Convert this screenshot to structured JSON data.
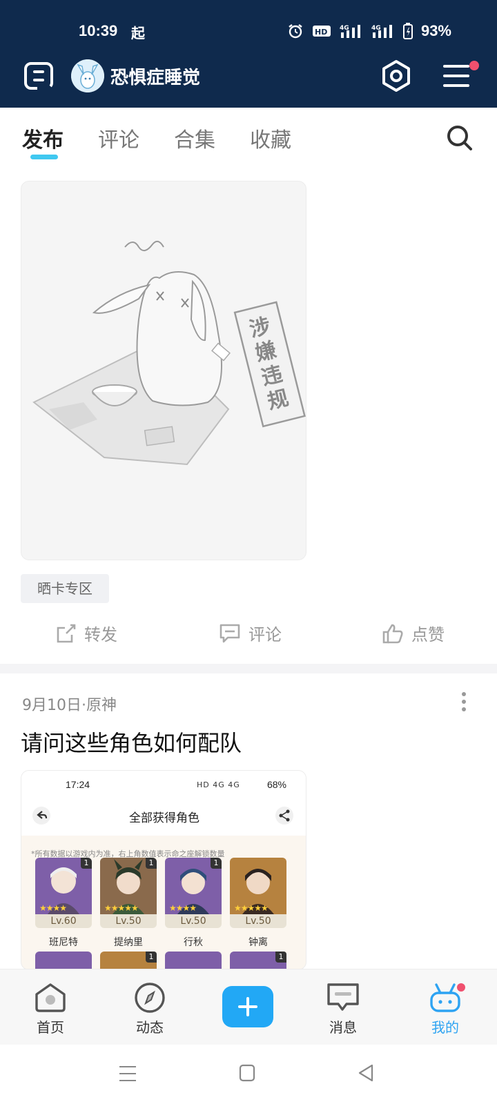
{
  "status_bar": {
    "time": "10:39",
    "extra": "起",
    "battery": "93%"
  },
  "header": {
    "username": "恐惧症睡觉",
    "has_notification_dot": true,
    "background_color": "#0f2a4d"
  },
  "tabs": [
    {
      "label": "发布",
      "active": true
    },
    {
      "label": "评论",
      "active": false
    },
    {
      "label": "合集",
      "active": false
    },
    {
      "label": "收藏",
      "active": false
    }
  ],
  "post1": {
    "image_text": "涉嫌违规",
    "tag": "晒卡专区",
    "actions": {
      "share": "转发",
      "comment": "评论",
      "like": "点赞"
    }
  },
  "post2": {
    "meta": "9月10日·原神",
    "title": "请问这些角色如何配队",
    "screenshot": {
      "time": "17:24",
      "status_icons": "HD 4G 4G",
      "battery": "68%",
      "title": "全部获得角色",
      "note": "*所有数据以游戏内为准，右上角数值表示命之座解锁数量",
      "characters": [
        {
          "name": "班尼特",
          "level": "Lv.60",
          "constellation": "1"
        },
        {
          "name": "提纳里",
          "level": "Lv.50",
          "constellation": "1"
        },
        {
          "name": "行秋",
          "level": "Lv.50",
          "constellation": "1"
        },
        {
          "name": "钟离",
          "level": "Lv.50",
          "constellation": ""
        }
      ],
      "row2_badges": [
        "",
        "1",
        "",
        "1"
      ]
    }
  },
  "bottom_nav": [
    {
      "label": "首页",
      "icon": "home-icon",
      "active": false
    },
    {
      "label": "动态",
      "icon": "compass-icon",
      "active": false
    },
    {
      "label": "",
      "icon": "plus-icon",
      "active": false
    },
    {
      "label": "消息",
      "icon": "message-icon",
      "active": false
    },
    {
      "label": "我的",
      "icon": "profile-icon",
      "active": true
    }
  ],
  "colors": {
    "accent": "#2ea3f2",
    "tab_underline": "#40c8f0",
    "notification": "#f0506e"
  }
}
